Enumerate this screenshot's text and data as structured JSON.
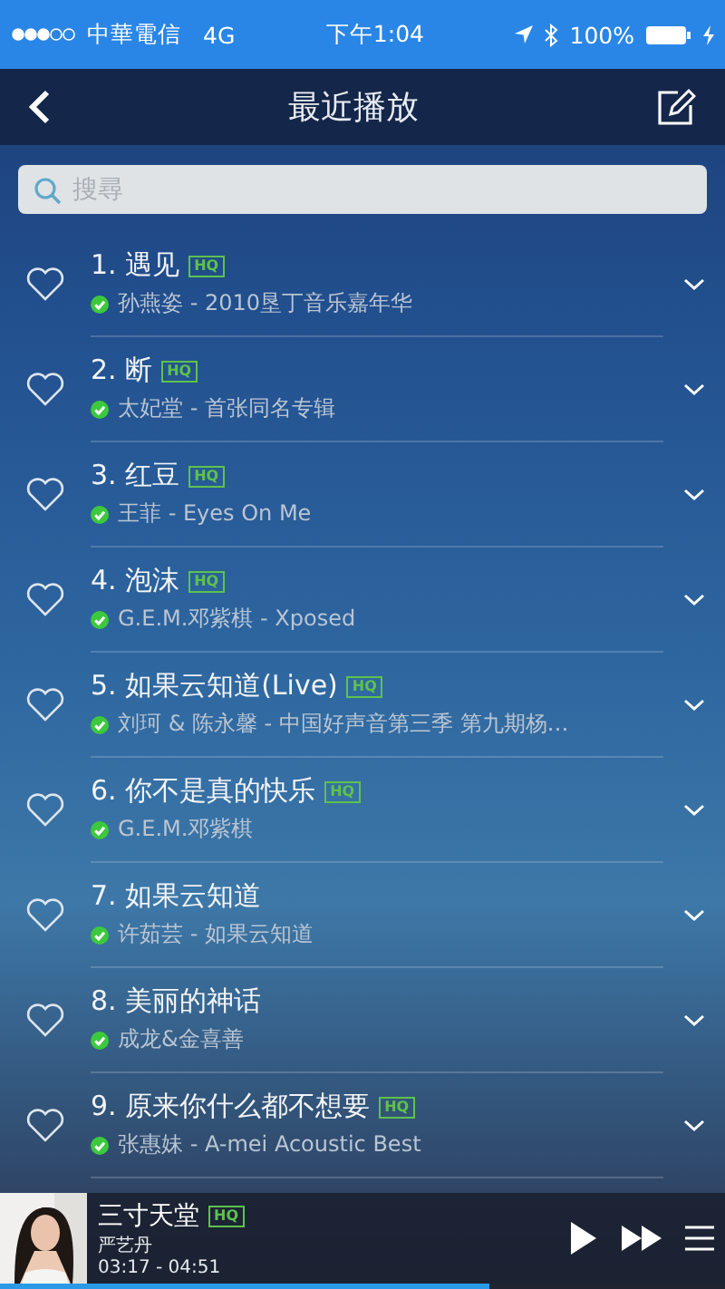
{
  "status_bar": {
    "carrier": "中華電信",
    "network": "4G",
    "time": "下午1:04",
    "battery": "100%"
  },
  "nav": {
    "title": "最近播放"
  },
  "search": {
    "placeholder": "搜尋"
  },
  "songs": [
    {
      "title": "1. 遇见",
      "badge": "HQ",
      "downloaded": true,
      "favorite": false,
      "subtitle": "孙燕姿 - 2010垦丁音乐嘉年华"
    },
    {
      "title": "2. 断",
      "badge": "HQ",
      "downloaded": true,
      "favorite": false,
      "subtitle": "太妃堂 - 首张同名专辑"
    },
    {
      "title": "3. 红豆",
      "badge": "HQ",
      "downloaded": true,
      "favorite": false,
      "subtitle": "王菲 - Eyes On Me"
    },
    {
      "title": "4. 泡沫",
      "badge": "HQ",
      "downloaded": true,
      "favorite": false,
      "subtitle": "G.E.M.邓紫棋 - Xposed"
    },
    {
      "title": "5. 如果云知道(Live)",
      "badge": "HQ",
      "downloaded": true,
      "favorite": false,
      "subtitle": "刘珂 & 陈永馨 - 中国好声音第三季 第九期杨…"
    },
    {
      "title": "6. 你不是真的快乐",
      "badge": "HQ",
      "downloaded": true,
      "favorite": false,
      "subtitle": "G.E.M.邓紫棋"
    },
    {
      "title": "7. 如果云知道",
      "downloaded": true,
      "favorite": false,
      "subtitle": "许茹芸 - 如果云知道"
    },
    {
      "title": "8. 美丽的神话",
      "downloaded": true,
      "favorite": false,
      "subtitle": "成龙&金喜善"
    },
    {
      "title": "9. 原来你什么都不想要",
      "badge": "HQ",
      "downloaded": true,
      "favorite": false,
      "subtitle": "张惠妹 - A-mei Acoustic Best"
    }
  ],
  "player": {
    "title": "三寸天堂",
    "badge": "HQ",
    "artist": "严艺丹",
    "time": "03:17 - 04:51",
    "level": 0.676
  }
}
